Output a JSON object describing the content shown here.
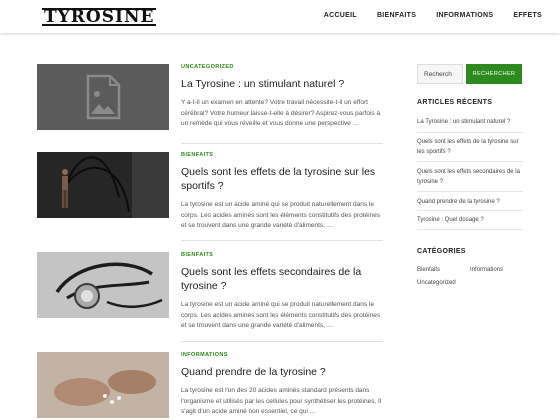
{
  "site": {
    "logo": "TYROSINE"
  },
  "nav": [
    "ACCUEIL",
    "BIENFAITS",
    "INFORMATIONS",
    "EFFETS"
  ],
  "posts": [
    {
      "category": "UNCATEGORIZED",
      "title": "La Tyrosine : un stimulant naturel ?",
      "excerpt": "Y a-t-il un examen en attente? Votre travail nécessite-t-il un effort cérébral? Votre humeur laisse-t-elle à désirer? Aspirez-vous parfois à un remède qui vous réveille et vous donne une perspective …",
      "image": "image-placeholder-icon"
    },
    {
      "category": "BIENFAITS",
      "title": "Quels sont les effets de la tyrosine sur les sportifs ?",
      "excerpt": "La tyrosine est un acide aminé qui se produit naturellement dans le corps. Les acides aminés sont les éléments constitutifs des protéines et se trouvent dans une grande variété d'aliments, …",
      "image": "battle-rope-athlete"
    },
    {
      "category": "BIENFAITS",
      "title": "Quels sont les effets secondaires de la tyrosine ?",
      "excerpt": "La tyrosine est un acide aminé qui se produit naturellement dans le corps. Les acides aminés sont les éléments constitutifs des protéines et se trouvent dans une grande variété d'aliments, …",
      "image": "stethoscope"
    },
    {
      "category": "INFORMATIONS",
      "title": "Quand prendre de la tyrosine ?",
      "excerpt": "La tyrosine est l'un des 20 acides aminés standard présents dans l'organisme et utilisés par les cellules pour synthétiser les protéines. Il s'agit d'un acide aminé non essentiel, ce qui …",
      "image": "hands-with-pills"
    }
  ],
  "sidebar": {
    "search": {
      "value": "Recherch",
      "button": "RECHERCHER"
    },
    "recent_title": "ARTICLES RÉCENTS",
    "recent": [
      "La Tyrosine : un stimulant naturel ?",
      "Quels sont les effets de la tyrosine sur les sportifs ?",
      "Quels sont les effets secondaires de la tyrosine ?",
      "Quand prendre de la tyrosine ?",
      "Tyrosine : Quel dosage ?"
    ],
    "categories_title": "CATÉGORIES",
    "categories": [
      "Bienfaits",
      "Informations",
      "Uncategorized"
    ]
  },
  "colors": {
    "accent": "#2d8a1e",
    "category": "#2f8a1f"
  }
}
